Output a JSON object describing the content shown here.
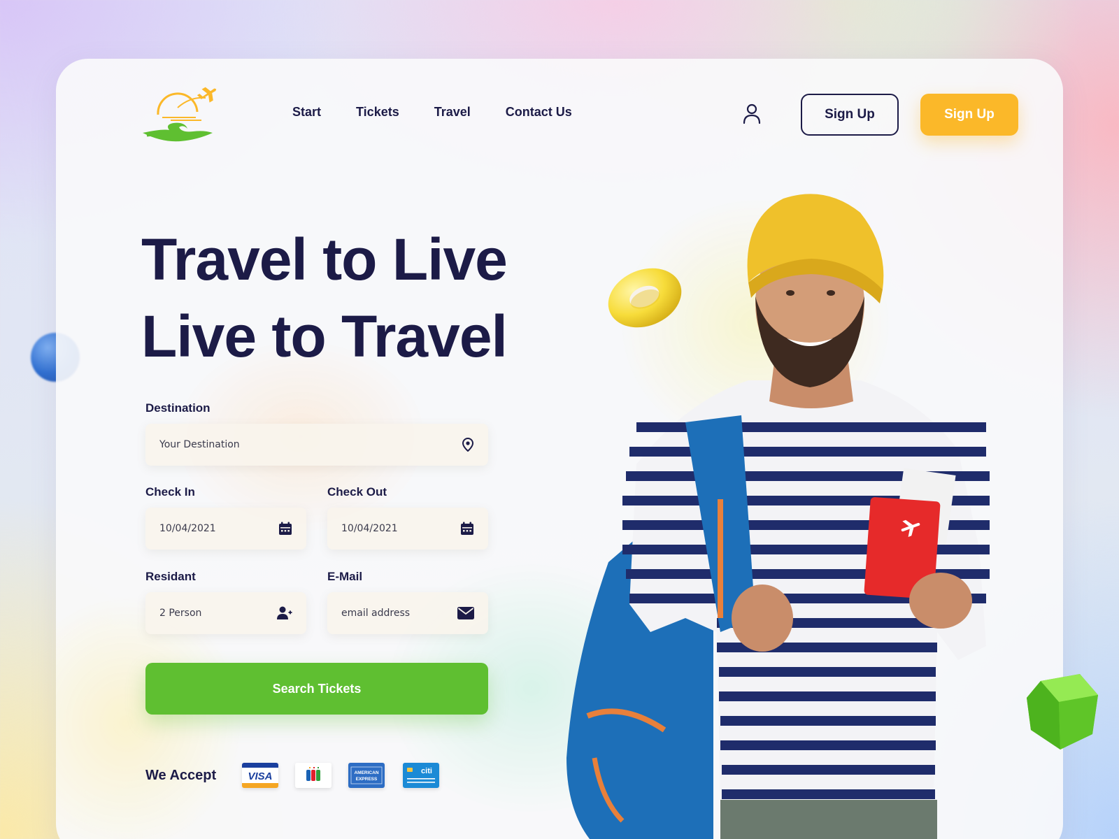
{
  "nav": {
    "items": [
      {
        "label": "Start"
      },
      {
        "label": "Tickets"
      },
      {
        "label": "Travel"
      },
      {
        "label": "Contact Us"
      }
    ]
  },
  "header": {
    "sign_up_outline": "Sign Up",
    "sign_up_solid": "Sign Up",
    "user_icon": "user-icon"
  },
  "hero": {
    "line1": "Travel to Live",
    "line2": "Live to Travel"
  },
  "form": {
    "destination": {
      "label": "Destination",
      "placeholder": "Your Destination",
      "icon": "map-pin-icon"
    },
    "check_in": {
      "label": "Check In",
      "value": "10/04/2021",
      "icon": "calendar-icon"
    },
    "check_out": {
      "label": "Check Out",
      "value": "10/04/2021",
      "icon": "calendar-icon"
    },
    "resident": {
      "label": "Residant",
      "value": "2 Person",
      "icon": "add-user-icon"
    },
    "email": {
      "label": "E-Mail",
      "placeholder": "email address",
      "icon": "envelope-icon"
    },
    "search_label": "Search Tickets"
  },
  "payments": {
    "label": "We Accept",
    "cards": [
      {
        "name": "visa",
        "text": "VISA"
      },
      {
        "name": "jcb",
        "text": ""
      },
      {
        "name": "american-express",
        "text": "AMERICAN EXPRESS"
      },
      {
        "name": "citi",
        "text": "citi"
      }
    ]
  },
  "colors": {
    "navy": "#1c1b47",
    "accent_yellow": "#fbb829",
    "accent_green": "#5fbf31"
  }
}
